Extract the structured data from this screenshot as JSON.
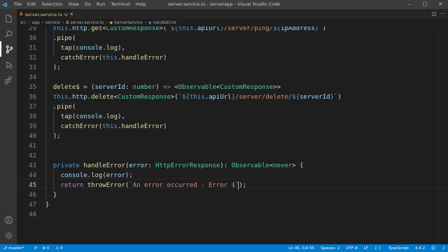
{
  "titlebar": {
    "menu": [
      "File",
      "Edit",
      "Selection",
      "View",
      "Go",
      "Run",
      "Terminal",
      "Help"
    ],
    "window_title": "server.service.ts - serverapp - Visual Studio Code",
    "controls": [
      "–",
      "□",
      "✕"
    ]
  },
  "activity_bar": {
    "items": [
      "explorer-icon",
      "search-icon",
      "source-control-icon",
      "run-debug-icon",
      "extensions-icon"
    ],
    "bottom_items": [
      "account-icon",
      "manage-gear-icon"
    ],
    "source_control_badge": ""
  },
  "tabs": [
    {
      "label": "server.service.ts",
      "modified_marker": "U",
      "active": true
    }
  ],
  "breadcrumb": [
    "src",
    "app",
    "service",
    "server.service.ts",
    "ServerService",
    "handleError"
  ],
  "editor": {
    "line_numbers": [
      "29",
      "30",
      "31",
      "32",
      "33",
      "34",
      "35",
      "36",
      "37",
      "38",
      "39",
      "40",
      "41",
      "42",
      "43",
      "44",
      "45",
      "46",
      "47",
      "48"
    ],
    "current_line": "45"
  },
  "statusbar": {
    "branch": "master*",
    "errors": "0",
    "warnings": "0",
    "position": "Ln 45, Col 55",
    "spaces": "Spaces: 2",
    "encoding": "UTF-8",
    "eol": "LF",
    "language": "TypeScript",
    "ts_version": "4.4.2"
  },
  "colors": {
    "statusbar_bg": "#007acc",
    "editor_bg": "#1e1e1e",
    "activitybar_bg": "#333333",
    "titlebar_bg": "#3c3c3c"
  }
}
